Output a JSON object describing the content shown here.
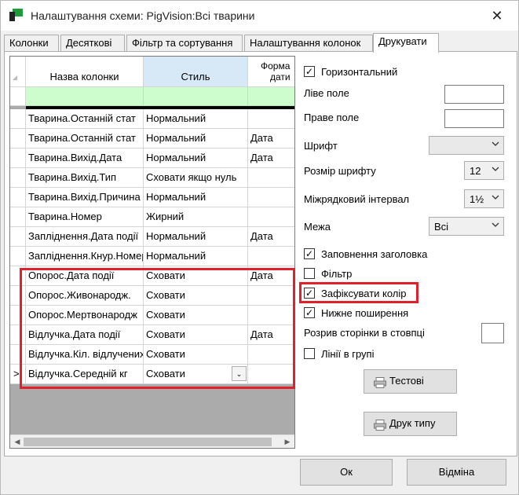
{
  "window": {
    "title": "Налаштування схеми: PigVision:Всі тварини",
    "close_glyph": "✕"
  },
  "tabs": [
    {
      "label": "Колонки"
    },
    {
      "label": "Десяткові"
    },
    {
      "label": "Фільтр та сортування"
    },
    {
      "label": "Налаштування колонок"
    },
    {
      "label": "Друкувати"
    }
  ],
  "grid": {
    "headers": {
      "name": "Назва колонки",
      "style": "Стиль",
      "format_line1": "Форма",
      "format_line2": "дати"
    },
    "rows": [
      {
        "name": "Тварина.Останній стат",
        "style": "Нормальний",
        "format": ""
      },
      {
        "name": "Тварина.Останній стат",
        "style": "Нормальний",
        "format": "Дата"
      },
      {
        "name": "Тварина.Вихід.Дата",
        "style": "Нормальний",
        "format": "Дата"
      },
      {
        "name": "Тварина.Вихід.Тип",
        "style": "Сховати якщо нуль",
        "format": ""
      },
      {
        "name": "Тварина.Вихід.Причина",
        "style": "Нормальний",
        "format": ""
      },
      {
        "name": "Тварина.Номер",
        "style": "Жирний",
        "format": ""
      },
      {
        "name": "Запліднення.Дата події",
        "style": "Нормальний",
        "format": "Дата"
      },
      {
        "name": "Запліднення.Кнур.Номер",
        "style": "Нормальний",
        "format": ""
      },
      {
        "name": "Опорос.Дата події",
        "style": "Сховати",
        "format": "Дата"
      },
      {
        "name": "Опорос.Живонародж.",
        "style": "Сховати",
        "format": ""
      },
      {
        "name": "Опорос.Мертвонародж",
        "style": "Сховати",
        "format": ""
      },
      {
        "name": "Відлучка.Дата події",
        "style": "Сховати",
        "format": "Дата"
      },
      {
        "name": "Відлучка.Кіл. відлучених",
        "style": "Сховати",
        "format": ""
      },
      {
        "name": "Відлучка.Середній кг",
        "style": "Сховати",
        "format": ""
      }
    ],
    "current_row_marker": ">"
  },
  "settings": {
    "horizontal": {
      "label": "Горизонтальний",
      "checked": true
    },
    "left_margin": {
      "label": "Ліве поле",
      "value": ""
    },
    "right_margin": {
      "label": "Праве поле",
      "value": ""
    },
    "font": {
      "label": "Шрифт",
      "value": ""
    },
    "font_size": {
      "label": "Розмір шрифту",
      "value": "12"
    },
    "line_spacing": {
      "label": "Міжрядковий інтервал",
      "value": "1½"
    },
    "borders": {
      "label": "Межа",
      "value": "Всі"
    },
    "header_fill": {
      "label": "Заповнення заголовка",
      "checked": true
    },
    "filter": {
      "label": "Фільтр",
      "checked": false
    },
    "fix_color": {
      "label": "Зафіксувати колір",
      "checked": true
    },
    "bottom_margins": {
      "label": "Нижне поширення",
      "checked": true
    },
    "page_break": {
      "label": "Розрив сторінки в стовпці",
      "value": ""
    },
    "group_lines": {
      "label": "Лінії в групі",
      "checked": false
    },
    "test_button": "Тестові",
    "print_type_button": "Друк типу",
    "check_glyph": "✓"
  },
  "footer": {
    "ok": "Ок",
    "cancel": "Відміна"
  },
  "colors": {
    "highlight_red": "#e0202a",
    "filter_row": "#cdfccd",
    "selected_header": "#d7e8f7"
  }
}
